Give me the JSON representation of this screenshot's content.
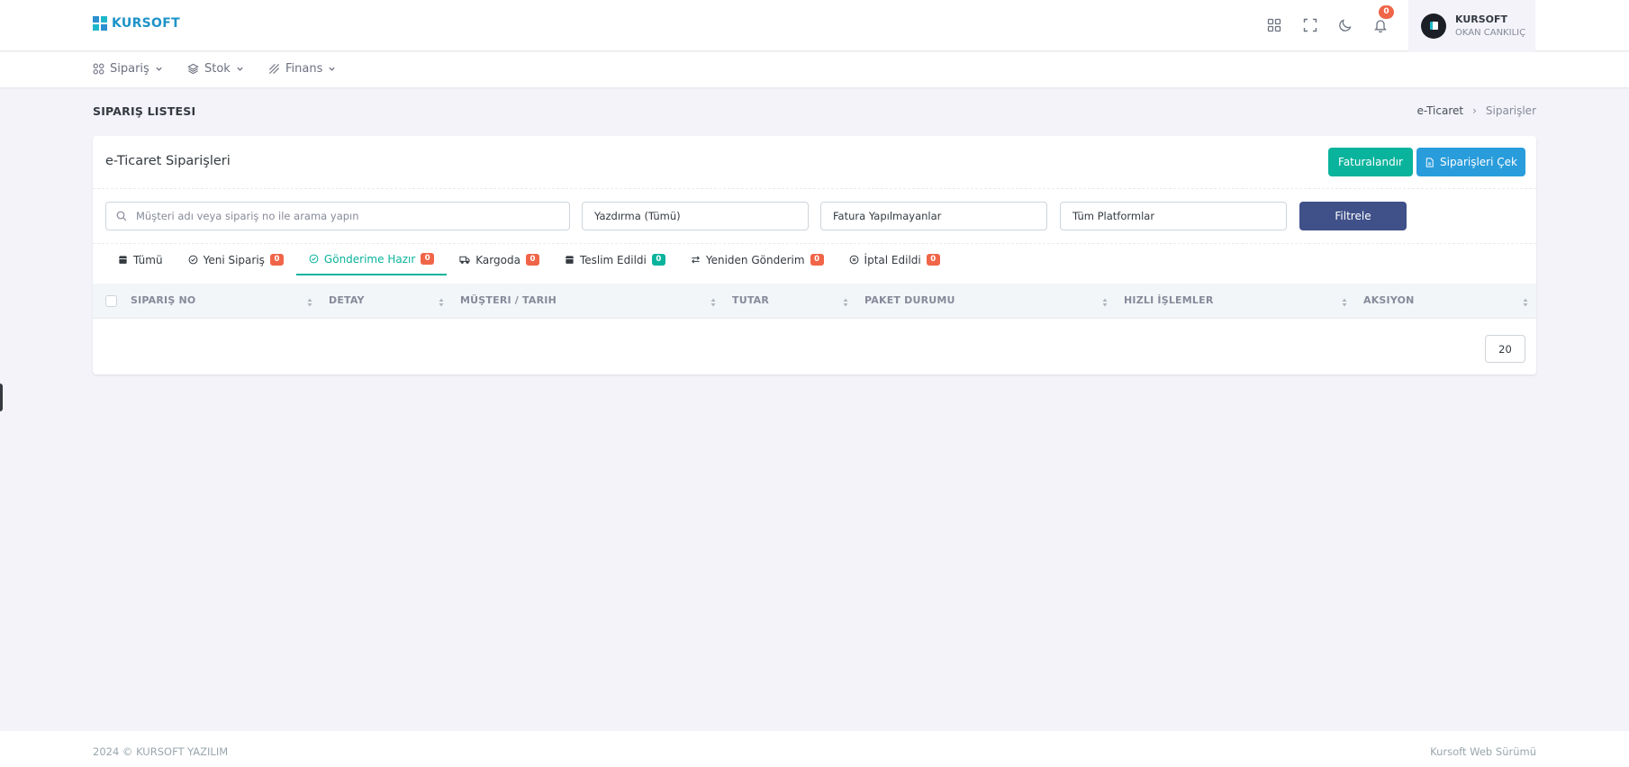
{
  "header": {
    "logo_text": "KURSOFT",
    "notification_count": "0",
    "user": {
      "name": "KURSOFT",
      "subtitle": "OKAN CANKILIÇ"
    }
  },
  "nav": {
    "items": [
      {
        "label": "Sipariş",
        "icon": "grid-icon"
      },
      {
        "label": "Stok",
        "icon": "layers-icon"
      },
      {
        "label": "Finans",
        "icon": "money-icon"
      }
    ]
  },
  "page": {
    "title": "SIPARIŞ LISTESI",
    "breadcrumb": {
      "parent": "e-Ticaret",
      "separator": "›",
      "current": "Siparişler"
    }
  },
  "card": {
    "title": "e-Ticaret Siparişleri",
    "buttons": {
      "invoice": "Faturalandır",
      "fetch": "Siparişleri Çek"
    },
    "filters": {
      "search_placeholder": "Müşteri adı veya sipariş no ile arama yapın",
      "print": "Yazdırma (Tümü)",
      "invoice": "Fatura Yapılmayanlar",
      "platform": "Tüm Platformlar",
      "submit": "Filtrele"
    },
    "tabs": [
      {
        "label": "Tümü",
        "count": null
      },
      {
        "label": "Yeni Sipariş",
        "count": "0"
      },
      {
        "label": "Gönderime Hazır",
        "count": "0"
      },
      {
        "label": "Kargoda",
        "count": "0"
      },
      {
        "label": "Teslim Edildi",
        "count": "0"
      },
      {
        "label": "Yeniden Gönderim",
        "count": "0"
      },
      {
        "label": "İptal Edildi",
        "count": "0"
      }
    ],
    "active_tab": "Gönderime Hazır",
    "table": {
      "columns": [
        "SIPARIŞ NO",
        "DETAY",
        "MÜŞTERI / TARIH",
        "TUTAR",
        "PAKET DURUMU",
        "HIZLI İŞLEMLER",
        "AKSIYON"
      ]
    },
    "page_size": "20"
  },
  "footer": {
    "left": "2024 © KURSOFT YAZILIM",
    "right": "Kursoft Web Sürümü"
  },
  "colors": {
    "primary": "#405189",
    "success": "#0ab39c",
    "info": "#299cdb",
    "danger": "#f06548",
    "background": "#f3f3f9"
  }
}
